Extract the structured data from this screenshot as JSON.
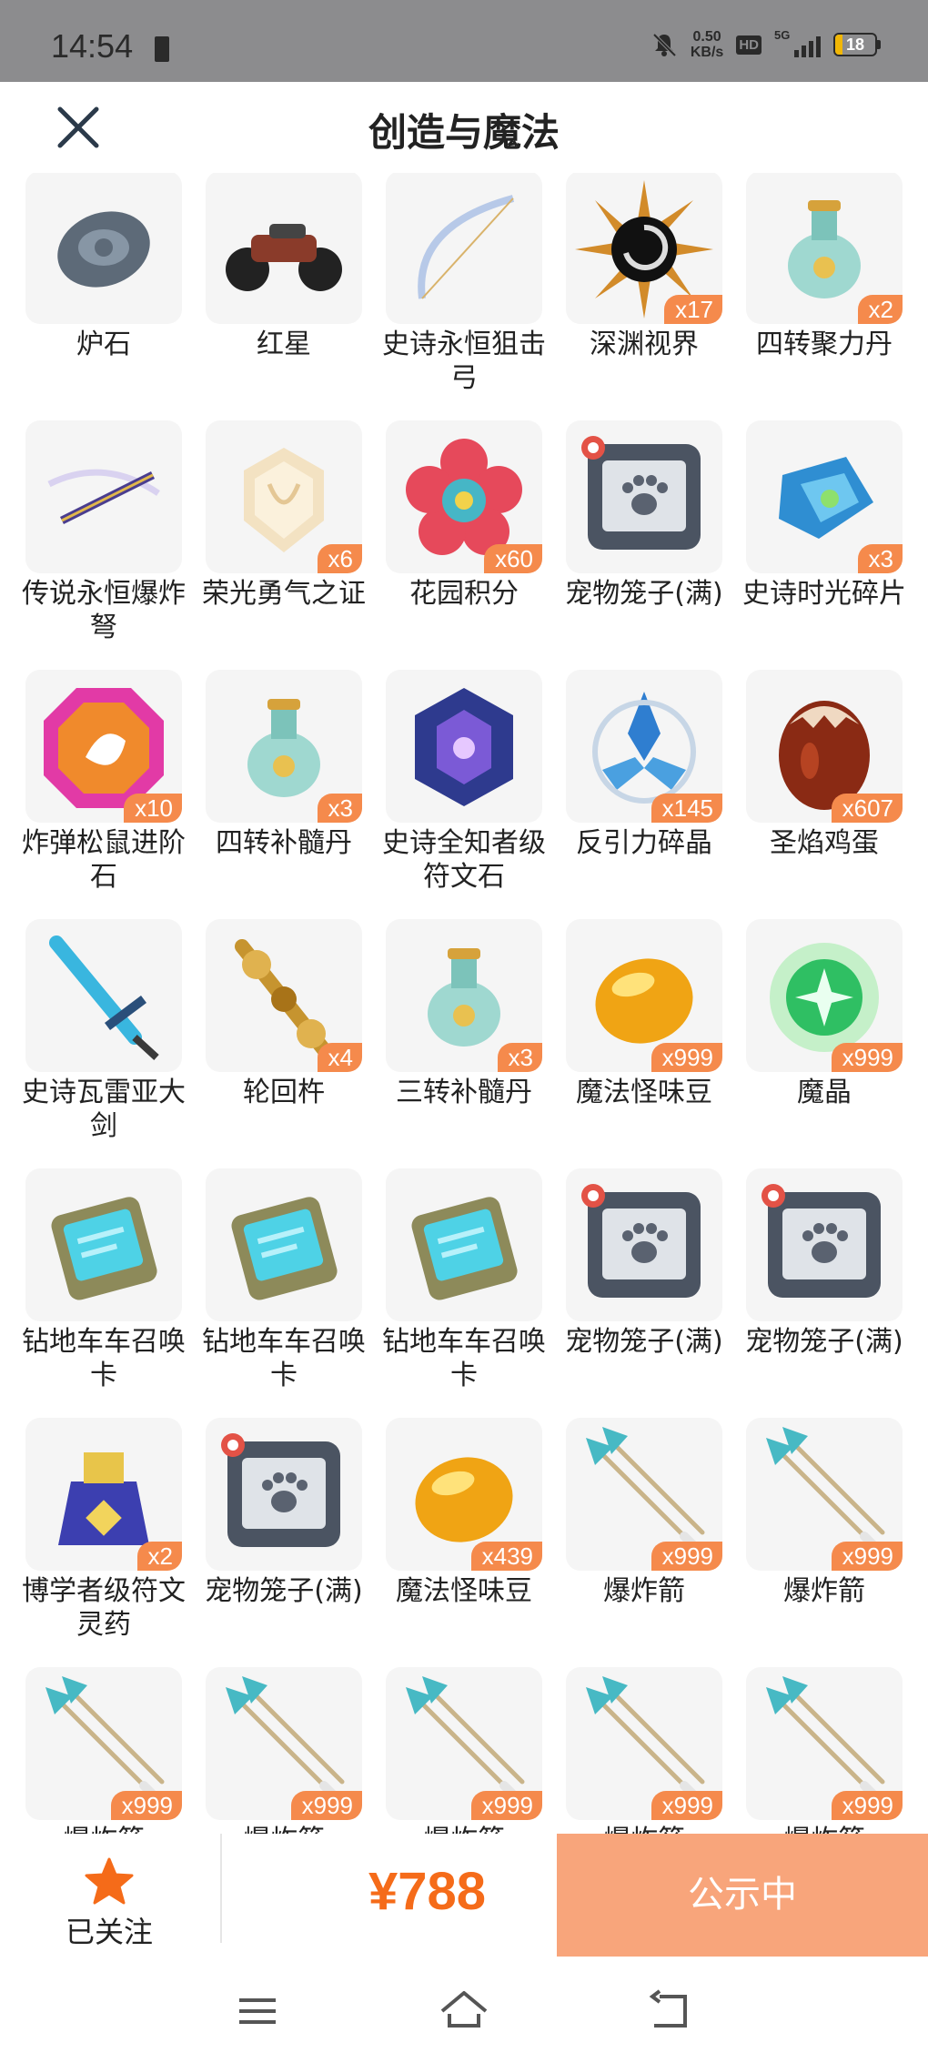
{
  "status_bar": {
    "time": "14:54",
    "speed_value": "0.50",
    "speed_unit": "KB/s",
    "hd": "HD",
    "network": "5G",
    "battery": "18",
    "battery_level": 0.18
  },
  "header": {
    "title": "创造与魔法"
  },
  "items": [
    {
      "name": "炉石",
      "count": "",
      "icon": "stone-icon"
    },
    {
      "name": "红星",
      "count": "",
      "icon": "motorcycle-icon"
    },
    {
      "name": "史诗永恒狙击弓",
      "count": "",
      "icon": "bow-icon"
    },
    {
      "name": "深渊视界",
      "count": "x17",
      "icon": "abyss-eye-icon"
    },
    {
      "name": "四转聚力丹",
      "count": "x2",
      "icon": "potion-icon"
    },
    {
      "name": "传说永恒爆炸弩",
      "count": "",
      "icon": "crossbow-icon"
    },
    {
      "name": "荣光勇气之证",
      "count": "x6",
      "icon": "emblem-icon"
    },
    {
      "name": "花园积分",
      "count": "x60",
      "icon": "flower-icon"
    },
    {
      "name": "宠物笼子(满)",
      "count": "",
      "icon": "pet-cage-icon"
    },
    {
      "name": "史诗时光碎片",
      "count": "x3",
      "icon": "shard-icon"
    },
    {
      "name": "炸弹松鼠进阶石",
      "count": "x10",
      "icon": "gem-icon"
    },
    {
      "name": "四转补髓丹",
      "count": "x3",
      "icon": "potion-icon"
    },
    {
      "name": "史诗全知者级符文石",
      "count": "",
      "icon": "rune-stone-icon"
    },
    {
      "name": "反引力碎晶",
      "count": "x145",
      "icon": "crystal-icon"
    },
    {
      "name": "圣焰鸡蛋",
      "count": "x607",
      "icon": "egg-icon"
    },
    {
      "name": "史诗瓦雷亚大剑",
      "count": "",
      "icon": "sword-icon"
    },
    {
      "name": "轮回杵",
      "count": "x4",
      "icon": "pestle-icon"
    },
    {
      "name": "三转补髓丹",
      "count": "x3",
      "icon": "potion-icon"
    },
    {
      "name": "魔法怪味豆",
      "count": "x999",
      "icon": "bean-icon"
    },
    {
      "name": "魔晶",
      "count": "x999",
      "icon": "magic-crystal-icon"
    },
    {
      "name": "钻地车车召唤卡",
      "count": "",
      "icon": "card-icon"
    },
    {
      "name": "钻地车车召唤卡",
      "count": "",
      "icon": "card-icon"
    },
    {
      "name": "钻地车车召唤卡",
      "count": "",
      "icon": "card-icon"
    },
    {
      "name": "宠物笼子(满)",
      "count": "",
      "icon": "pet-cage-icon"
    },
    {
      "name": "宠物笼子(满)",
      "count": "",
      "icon": "pet-cage-icon"
    },
    {
      "name": "博学者级符文灵药",
      "count": "x2",
      "icon": "elixir-icon"
    },
    {
      "name": "宠物笼子(满)",
      "count": "",
      "icon": "pet-cage-icon"
    },
    {
      "name": "魔法怪味豆",
      "count": "x439",
      "icon": "bean-icon"
    },
    {
      "name": "爆炸箭",
      "count": "x999",
      "icon": "arrow-icon"
    },
    {
      "name": "爆炸箭",
      "count": "x999",
      "icon": "arrow-icon"
    },
    {
      "name": "爆炸箭",
      "count": "x999",
      "icon": "arrow-icon"
    },
    {
      "name": "爆炸箭",
      "count": "x999",
      "icon": "arrow-icon"
    },
    {
      "name": "爆炸箭",
      "count": "x999",
      "icon": "arrow-icon"
    },
    {
      "name": "爆炸箭",
      "count": "x999",
      "icon": "arrow-icon"
    },
    {
      "name": "爆炸箭",
      "count": "x999",
      "icon": "arrow-icon"
    }
  ],
  "bottom": {
    "follow_label": "已关注",
    "price": "¥788",
    "status_button": "公示中"
  },
  "colors": {
    "accent": "#f56b19",
    "badge": "#f58a4c",
    "status_button": "#f8a57b",
    "star": "#f56b19"
  }
}
